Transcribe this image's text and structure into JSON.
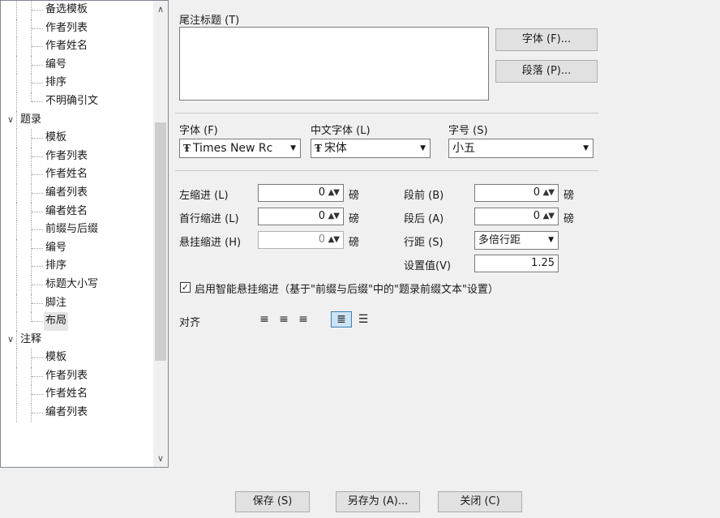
{
  "tree": {
    "items": [
      {
        "label": "备选模板",
        "kind": "child"
      },
      {
        "label": "作者列表",
        "kind": "child"
      },
      {
        "label": "作者姓名",
        "kind": "child"
      },
      {
        "label": "编号",
        "kind": "child"
      },
      {
        "label": "排序",
        "kind": "child"
      },
      {
        "label": "不明确引文",
        "kind": "child-last"
      },
      {
        "label": "题录",
        "kind": "parent"
      },
      {
        "label": "模板",
        "kind": "child"
      },
      {
        "label": "作者列表",
        "kind": "child"
      },
      {
        "label": "作者姓名",
        "kind": "child"
      },
      {
        "label": "编者列表",
        "kind": "child"
      },
      {
        "label": "编者姓名",
        "kind": "child"
      },
      {
        "label": "前缀与后缀",
        "kind": "child"
      },
      {
        "label": "编号",
        "kind": "child"
      },
      {
        "label": "排序",
        "kind": "child"
      },
      {
        "label": "标题大小写",
        "kind": "child"
      },
      {
        "label": "脚注",
        "kind": "child"
      },
      {
        "label": "布局",
        "kind": "child-last",
        "selected": true
      },
      {
        "label": "注释",
        "kind": "parent"
      },
      {
        "label": "模板",
        "kind": "child"
      },
      {
        "label": "作者列表",
        "kind": "child"
      },
      {
        "label": "作者姓名",
        "kind": "child"
      },
      {
        "label": "编者列表",
        "kind": "child"
      }
    ],
    "scroll_up": "∧",
    "scroll_down": "∨"
  },
  "endnote_title": {
    "label": "尾注标题 (T)",
    "value": "",
    "font_button": "字体 (F)...",
    "paragraph_button": "段落 (P)..."
  },
  "font_row": {
    "font_label": "字体 (F)",
    "font_value": "Times New Rc",
    "cjk_label": "中文字体 (L)",
    "cjk_value": "宋体",
    "size_label": "字号 (S)",
    "size_value": "小五",
    "font_icon": "TrueType"
  },
  "indent": {
    "left_label": "左缩进 (L)",
    "left_value": "0",
    "left_unit": "磅",
    "first_label": "首行缩进 (L)",
    "first_value": "0",
    "first_unit": "磅",
    "hanging_label": "悬挂缩进 (H)",
    "hanging_value": "0",
    "hanging_unit": "磅",
    "before_label": "段前 (B)",
    "before_value": "0",
    "before_unit": "磅",
    "after_label": "段后 (A)",
    "after_value": "0",
    "after_unit": "磅",
    "spacing_label": "行距 (S)",
    "spacing_value": "多倍行距",
    "setting_label": "设置值(V)",
    "setting_value": "1.25"
  },
  "smart_hanging": {
    "checked": true,
    "label": "启用智能悬挂缩进（基于\"前缀与后缀\"中的\"题录前缀文本\"设置）"
  },
  "alignment": {
    "label": "对齐",
    "options": [
      "align-left",
      "align-center",
      "align-right",
      "justify",
      "distributed"
    ],
    "active": "justify"
  },
  "footer": {
    "save": "保存 (S)",
    "save_as": "另存为 (A)...",
    "close": "关闭 (C)"
  }
}
